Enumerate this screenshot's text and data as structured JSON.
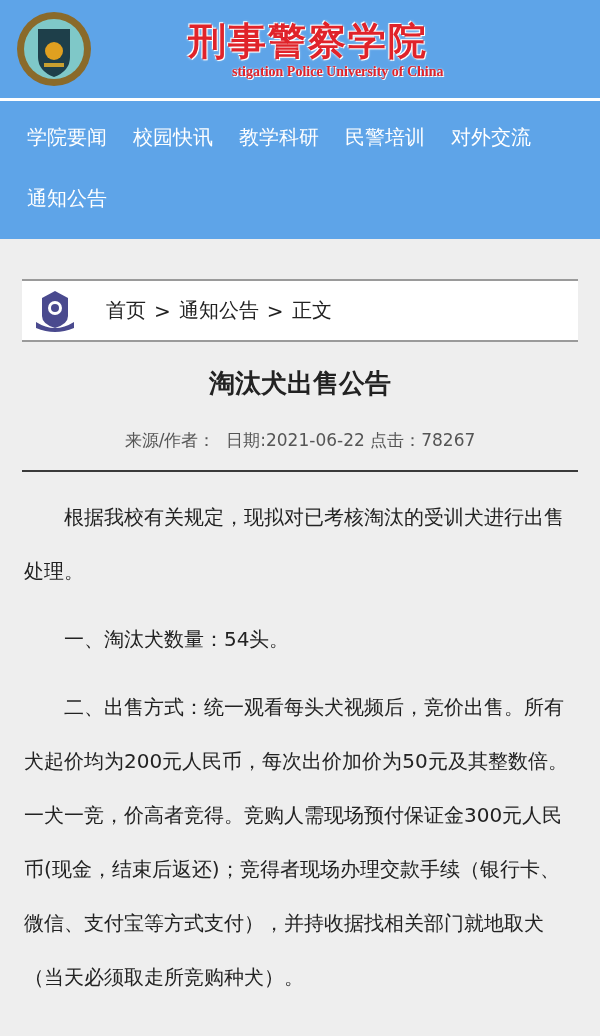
{
  "header": {
    "title": "刑事警察学院",
    "subtitle": "stigation Police University of China"
  },
  "nav": {
    "items": [
      {
        "label": "学院要闻"
      },
      {
        "label": "校园快讯"
      },
      {
        "label": "教学科研"
      },
      {
        "label": "民警培训"
      },
      {
        "label": "对外交流"
      },
      {
        "label": "通知公告"
      }
    ]
  },
  "breadcrumb": {
    "items": [
      "首页",
      "通知公告",
      "正文"
    ],
    "separator": ">"
  },
  "article": {
    "title": "淘汰犬出售公告",
    "meta": "来源/作者：  日期:2021-06-22 点击：78267",
    "paragraphs": [
      "根据我校有关规定，现拟对已考核淘汰的受训犬进行出售处理。",
      "一、淘汰犬数量：54头。",
      "二、出售方式：统一观看每头犬视频后，竞价出售。所有犬起价均为200元人民币，每次出价加价为50元及其整数倍。一犬一竞，价高者竞得。竞购人需现场预付保证金300元人民币(现金，结束后返还)；竞得者现场办理交款手续（银行卡、微信、支付宝等方式支付），并持收据找相关部门就地取犬（当天必须取走所竞购种犬）。"
    ]
  }
}
